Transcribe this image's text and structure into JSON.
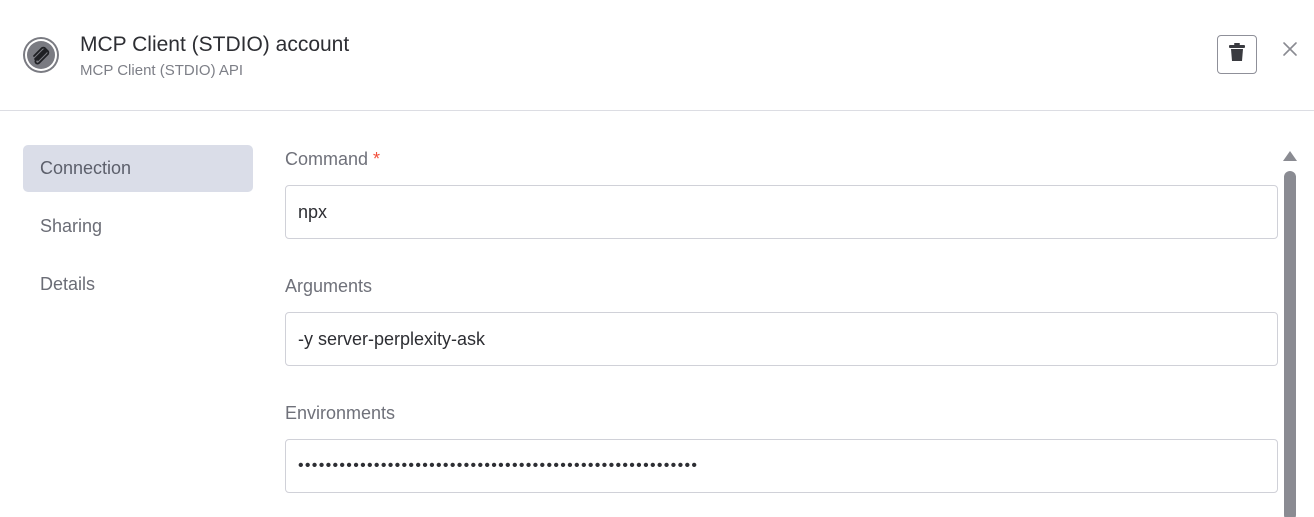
{
  "header": {
    "title": "MCP Client (STDIO) account",
    "subtitle": "MCP Client (STDIO) API",
    "app_icon": "paperclip-icon",
    "delete_icon": "trash-icon",
    "close_icon": "close-icon"
  },
  "sidebar": {
    "items": [
      {
        "label": "Connection",
        "active": true
      },
      {
        "label": "Sharing",
        "active": false
      },
      {
        "label": "Details",
        "active": false
      }
    ]
  },
  "form": {
    "command": {
      "label": "Command",
      "required_mark": "*",
      "value": "npx"
    },
    "arguments": {
      "label": "Arguments",
      "value": "-y server-perplexity-ask"
    },
    "environments": {
      "label": "Environments",
      "value": "••••••••••••••••••••••••••••••••••••••••••••••••••••••••••"
    }
  },
  "colors": {
    "accent_required": "#f24e3a",
    "active_nav_bg": "#dadde8",
    "border": "#d0d1d8"
  }
}
